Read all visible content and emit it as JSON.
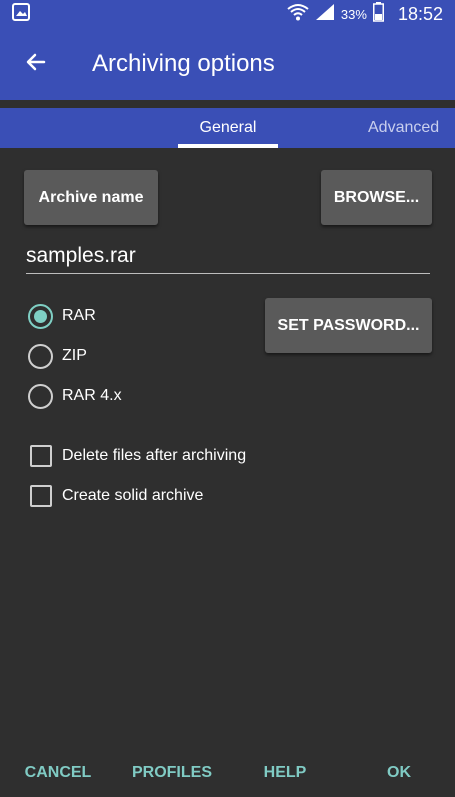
{
  "status_bar": {
    "battery_percent": "33%",
    "time": "18:52",
    "icons": [
      "image-icon",
      "wifi-icon",
      "signal-icon",
      "battery-icon"
    ]
  },
  "app_bar": {
    "title": "Archiving options",
    "back_icon": "arrow-left-icon"
  },
  "tabs": [
    {
      "label": "General",
      "selected": true
    },
    {
      "label": "Advanced",
      "selected": false
    }
  ],
  "general": {
    "archive_name_button": "Archive name",
    "browse_button": "BROWSE...",
    "archive_name_value": "samples.rar",
    "formats": [
      {
        "label": "RAR",
        "selected": true
      },
      {
        "label": "ZIP",
        "selected": false
      },
      {
        "label": "RAR 4.x",
        "selected": false
      }
    ],
    "set_password_button": "SET PASSWORD...",
    "options": [
      {
        "label": "Delete files after archiving",
        "checked": false
      },
      {
        "label": "Create solid archive",
        "checked": false
      }
    ]
  },
  "bottom_bar": {
    "cancel": "CANCEL",
    "profiles": "PROFILES",
    "help": "HELP",
    "ok": "OK"
  },
  "colors": {
    "primary": "#3a4fb6",
    "background": "#2f2f2f",
    "button": "#5a5a5a",
    "accent": "#80cbc4"
  }
}
